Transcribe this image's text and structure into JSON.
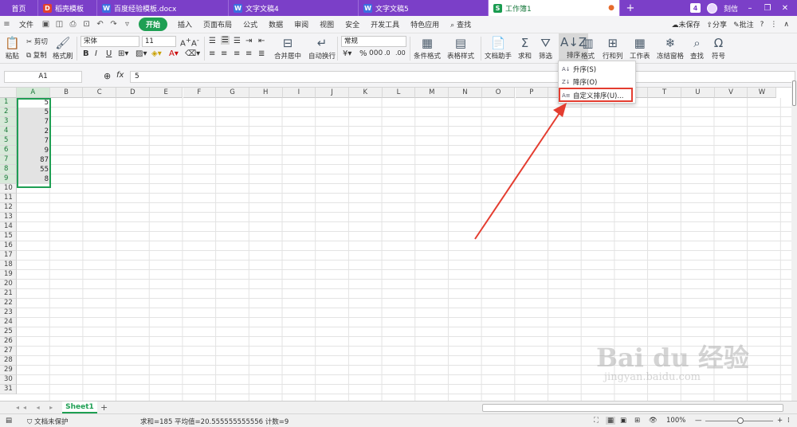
{
  "tabs": {
    "home": "首页",
    "t1": "稻壳模板",
    "t2": "百度经验模板.docx",
    "t3": "文字文稿4",
    "t4": "文字文稿5",
    "t5": "工作簿1",
    "badge": "4",
    "user": "刻信"
  },
  "menu": {
    "file": "文件",
    "items": [
      "开始",
      "插入",
      "页面布局",
      "公式",
      "数据",
      "审阅",
      "视图",
      "安全",
      "开发工具",
      "特色应用"
    ],
    "search": "查找",
    "unsaved": "未保存",
    "share": "分享",
    "comment": "批注"
  },
  "ribbon": {
    "paste": "粘贴",
    "cut": "剪切",
    "copy": "复制",
    "format_painter": "格式刷",
    "font_name": "宋体",
    "font_size": "11",
    "number_format": "常规",
    "merge": "合并居中",
    "wrap": "自动换行",
    "cond_format": "条件格式",
    "table_style": "表格样式",
    "doc_helper": "文档助手",
    "sum": "求和",
    "filter": "筛选",
    "sort": "排序",
    "format": "格式",
    "row_col": "行和列",
    "worksheet": "工作表",
    "freeze": "冻结窗格",
    "find": "查找",
    "symbol": "符号"
  },
  "formula_bar": {
    "name_box": "A1",
    "fx": "fx",
    "value": "5"
  },
  "columns": [
    "A",
    "B",
    "C",
    "D",
    "E",
    "F",
    "G",
    "H",
    "I",
    "J",
    "K",
    "L",
    "M",
    "N",
    "O",
    "P",
    "Q",
    "R",
    "S",
    "T",
    "U",
    "V",
    "W"
  ],
  "rows": [
    "1",
    "2",
    "3",
    "4",
    "5",
    "6",
    "7",
    "8",
    "9",
    "10",
    "11",
    "12",
    "13",
    "14",
    "15",
    "16",
    "17",
    "18",
    "19",
    "20",
    "21",
    "22",
    "23",
    "24",
    "25",
    "26",
    "27",
    "28",
    "29",
    "30",
    "31"
  ],
  "cells_a": [
    "5",
    "5",
    "7",
    "2",
    "7",
    "9",
    "87",
    "55",
    "8"
  ],
  "sort_menu": {
    "asc": "升序(S)",
    "desc": "降序(O)",
    "custom": "自定义排序(U)..."
  },
  "sheet": {
    "name": "Sheet1",
    "add": "+"
  },
  "status": {
    "protect": "文档未保护",
    "summary": "求和=185  平均值=20.555555555556  计数=9",
    "zoom": "100%"
  },
  "watermark": {
    "brand": "Bai du 经验",
    "url": "jingyan.baidu.com"
  },
  "colors": {
    "accent": "#1e9f53",
    "titlebar": "#7b3fc8",
    "highlight": "#e43d30",
    "arrow": "#e43d30"
  }
}
